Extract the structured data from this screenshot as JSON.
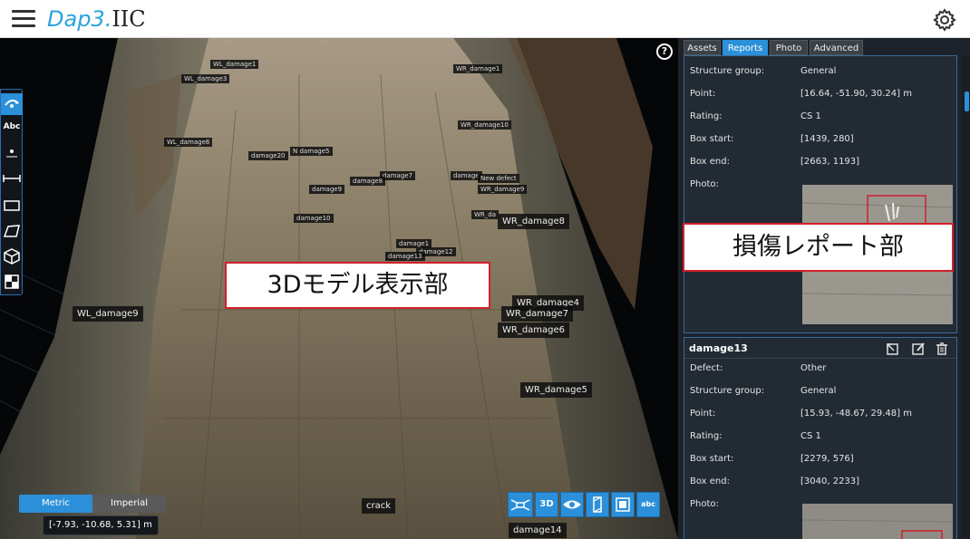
{
  "app": {
    "logo_part1": "Dap3.",
    "logo_part2": "IIC"
  },
  "viewport": {
    "labels": [
      {
        "text": "WL_damage3"
      },
      {
        "text": "WL_damage1"
      },
      {
        "text": "WR_damage1"
      },
      {
        "text": "WR_damage10"
      },
      {
        "text": "WL_damage6"
      },
      {
        "text": "damage20"
      },
      {
        "text": "N damage5"
      },
      {
        "text": "damage7"
      },
      {
        "text": "damage8"
      },
      {
        "text": "damage9"
      },
      {
        "text": "damage"
      },
      {
        "text": "New defect"
      },
      {
        "text": "WR_damage9"
      },
      {
        "text": "damage10"
      },
      {
        "text": "WR_da"
      },
      {
        "text": "WR_damage8"
      },
      {
        "text": "damage1"
      },
      {
        "text": "damage12"
      },
      {
        "text": "damage13"
      },
      {
        "text": "WL_damage9"
      },
      {
        "text": "WR_damage4"
      },
      {
        "text": "WR_damage7"
      },
      {
        "text": "WR_damage6"
      },
      {
        "text": "WR_damage5"
      },
      {
        "text": "crack"
      },
      {
        "text": "damage14"
      }
    ],
    "callout_model": "3Dモデル表示部",
    "units": {
      "metric": "Metric",
      "imperial": "Imperial",
      "selected": "Metric"
    },
    "coordinate": "[-7.93, -10.68, 5.31] m",
    "help_label": "?",
    "toolbar": {
      "text_tool": "Abc",
      "viewbar_3d": "3D",
      "viewbar_abc": "abc"
    }
  },
  "panel": {
    "tabs": [
      {
        "label": "Assets",
        "active": false
      },
      {
        "label": "Reports",
        "active": true
      },
      {
        "label": "Photo",
        "active": false
      },
      {
        "label": "Advanced",
        "active": false
      }
    ],
    "callout_report": "損傷レポート部",
    "report1": {
      "structure_group_label": "Structure group:",
      "structure_group": "General",
      "point_label": "Point:",
      "point": "[16.64, -51.90, 30.24] m",
      "rating_label": "Rating:",
      "rating": "CS 1",
      "box_start_label": "Box start:",
      "box_start": "[1439, 280]",
      "box_end_label": "Box end:",
      "box_end": "[2663, 1193]",
      "photo_label": "Photo:"
    },
    "report2": {
      "title": "damage13",
      "defect_label": "Defect:",
      "defect": "Other",
      "structure_group_label": "Structure group:",
      "structure_group": "General",
      "point_label": "Point:",
      "point": "[15.93, -48.67, 29.48] m",
      "rating_label": "Rating:",
      "rating": "CS 1",
      "box_start_label": "Box start:",
      "box_start": "[2279, 576]",
      "box_end_label": "Box end:",
      "box_end": "[3040, 2233]",
      "photo_label": "Photo:"
    }
  },
  "colors": {
    "accent": "#2b90d9",
    "callout_border": "#d0202a"
  }
}
